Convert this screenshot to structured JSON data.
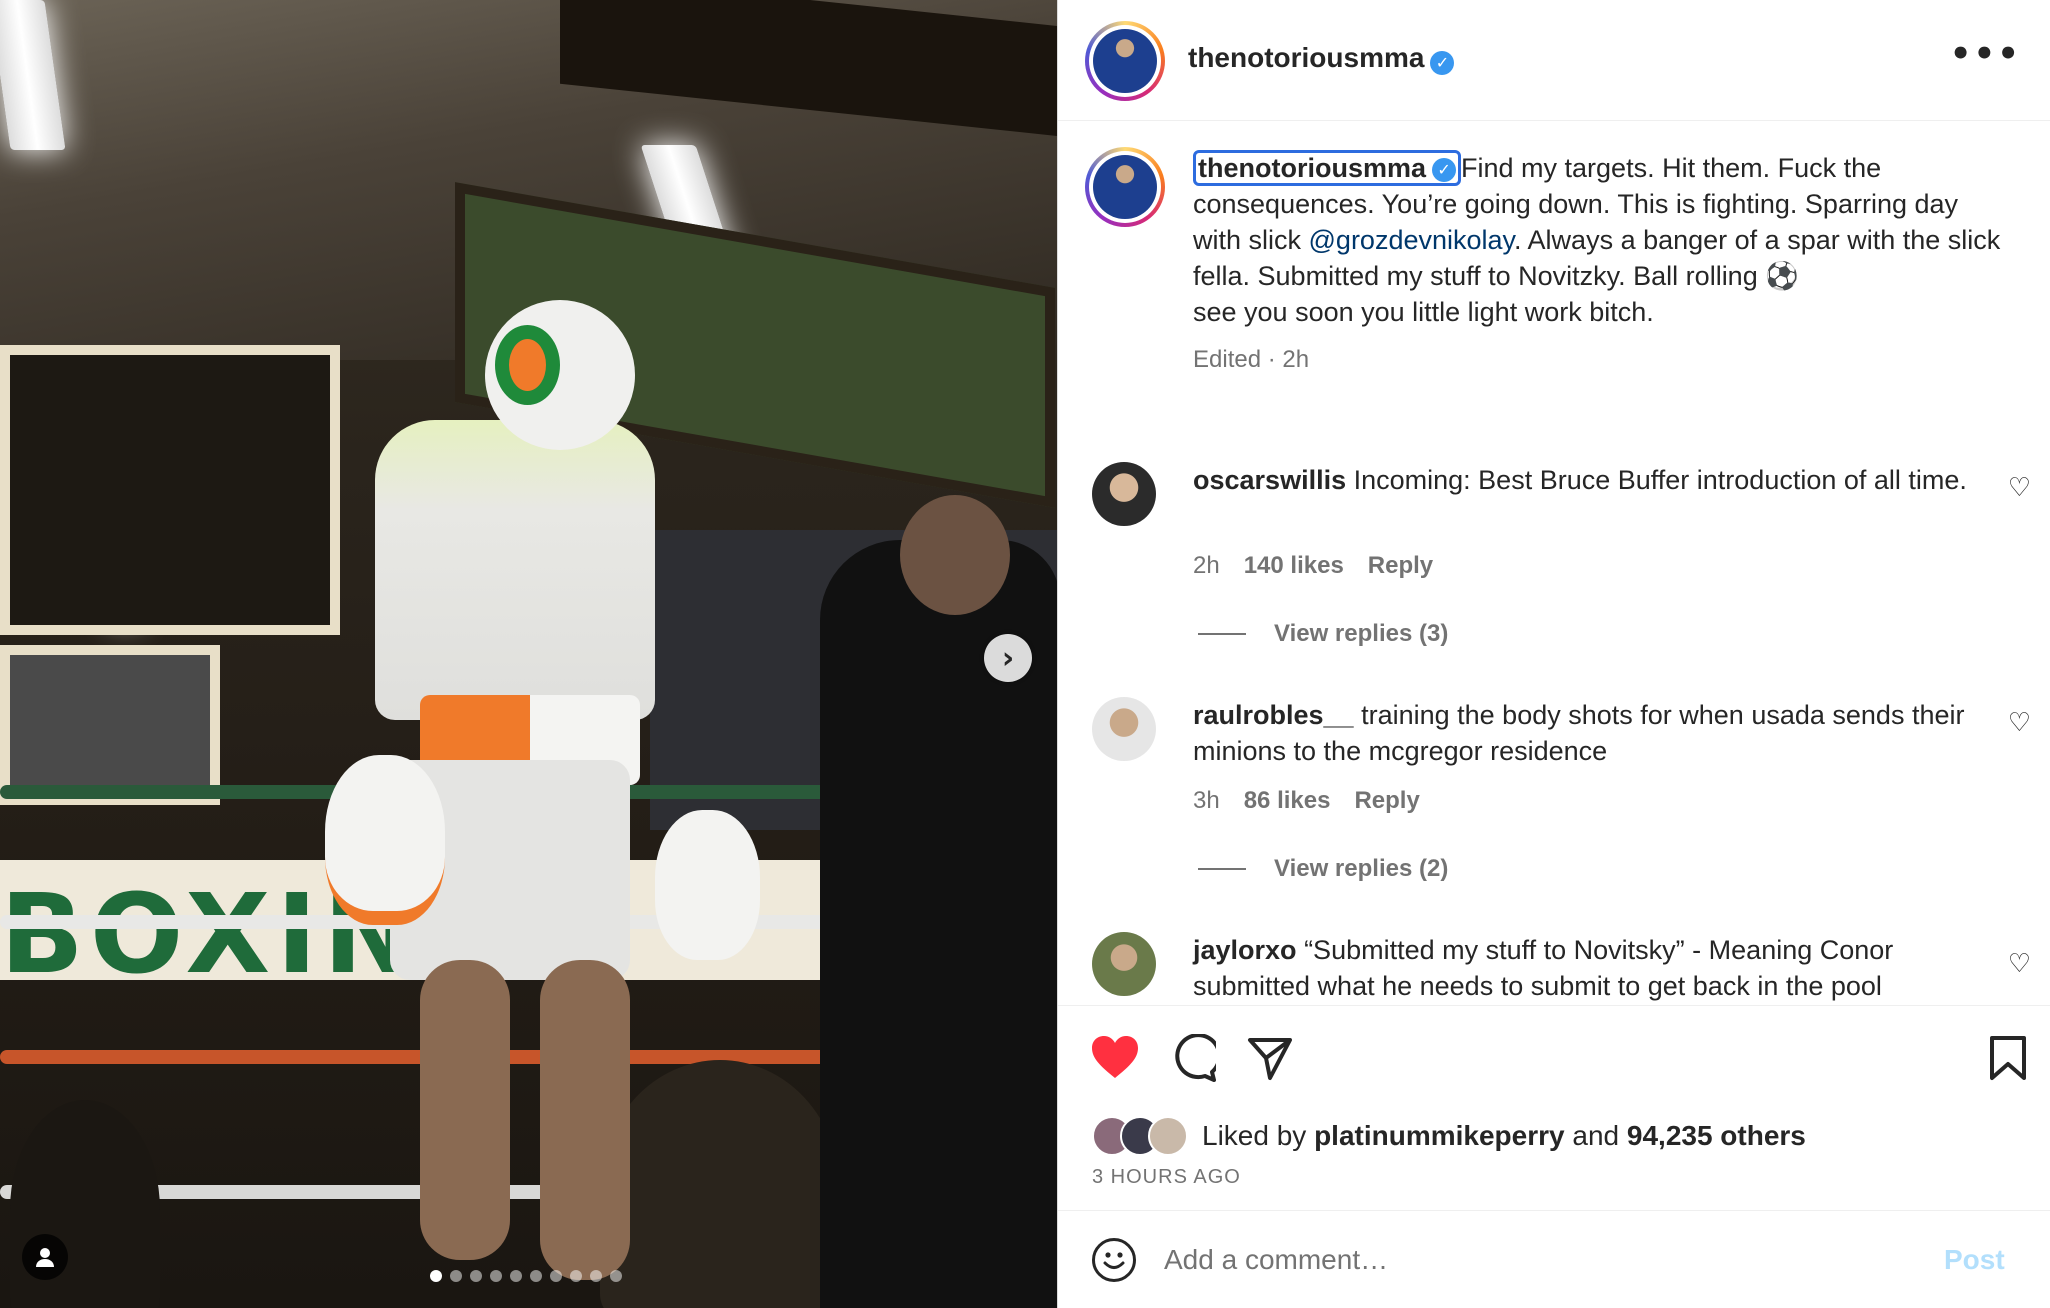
{
  "post": {
    "username": "thenotoriousmma",
    "verified_mark": "✓",
    "more_label": "•••",
    "caption_text": "Find my targets. Hit them. Fuck the consequences. You’re going down. This is fighting. Sparring day with slick ",
    "caption_mention": "@grozdevnikolay",
    "caption_text_2": ". Always a banger of a spar with the slick fella. Submitted my stuff to Novitzky. Ball rolling ⚽",
    "caption_text_3": "see you soon you little light work bitch.",
    "caption_meta": "Edited · 2h"
  },
  "photo": {
    "banner_text": "BOXING",
    "next_icon": "›",
    "dot_count": 10,
    "active_dot": 0
  },
  "comments": [
    {
      "username": "oscarswillis",
      "text": "Incoming: Best Bruce Buffer introduction of all time.",
      "time": "2h",
      "likes": "140 likes",
      "reply": "Reply",
      "view_replies": "View replies (3)"
    },
    {
      "username": "raulrobles__",
      "text": "training the body shots for when usada sends their minions to the mcgregor residence",
      "time": "3h",
      "likes": "86 likes",
      "reply": "Reply",
      "view_replies": "View replies (2)"
    },
    {
      "username": "jaylorxo",
      "text": "“Submitted my stuff to Novitsky” - Meaning Conor submitted what he needs to submit to get back in the pool"
    }
  ],
  "actions": {
    "liked_by_prefix": "Liked by ",
    "liked_by_user": "platinummikeperry",
    "liked_by_mid": " and ",
    "liked_by_count": "94,235 others",
    "time_ago": "3 HOURS AGO"
  },
  "comment_box": {
    "placeholder": "Add a comment…",
    "post_label": "Post"
  },
  "colors": {
    "like_red": "#ff3040",
    "verified_blue": "#3897f0",
    "link_blue": "#00376b",
    "muted": "#737373"
  }
}
